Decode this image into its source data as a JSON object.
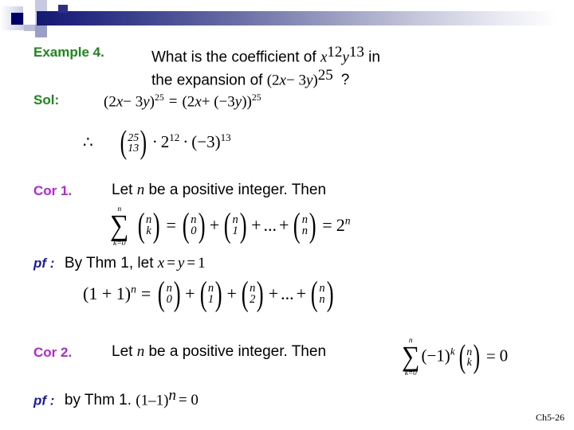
{
  "slide": {
    "footer": "Ch5-26",
    "colors": {
      "example_label": "#1a8a1a",
      "cor_label": "#bb22dd",
      "pf_label": "#1a1aaa",
      "banner_dark": "#141a6e",
      "banner_accent": "#000066"
    }
  },
  "example": {
    "label": "Example 4.",
    "question_line1_pre": "What is the coefficient of ",
    "question_x": "x",
    "question_x_exp": "12",
    "question_y": "y",
    "question_y_exp": "13",
    "question_line1_post": " in",
    "question_line2_pre": "the expansion of ",
    "expr_open": "(2",
    "expr_x": "x",
    "expr_minus": "− 3",
    "expr_y": "y",
    "expr_close": ")",
    "expr_exp": "25",
    "question_mark": "?"
  },
  "sol": {
    "label": "Sol:",
    "equation": {
      "lhs_open": "(2",
      "lhs_x": "x",
      "lhs_minus": "− 3",
      "lhs_y": "y",
      "lhs_close": ")",
      "lhs_exp": "25",
      "equals": "=",
      "rhs_open": "(2",
      "rhs_x": "x",
      "rhs_plus": "+ (−3",
      "rhs_y": "y",
      "rhs_close": "))",
      "rhs_exp": "25"
    },
    "therefore_symbol": "∴",
    "result": {
      "binom_top": "25",
      "binom_bottom": "13",
      "dot1": "·",
      "term2_base": "2",
      "term2_exp": "12",
      "dot2": "·",
      "term3_base": "(−3)",
      "term3_exp": "13"
    }
  },
  "cor1": {
    "label": "Cor 1.",
    "statement_pre": "Let ",
    "statement_var": "n",
    "statement_post": " be a positive integer. Then",
    "formula": {
      "sum_upper": "n",
      "sum_sigma": "∑",
      "sum_lower": "k=0",
      "binom_top": "n",
      "binom_bottom": "k",
      "eq1": "=",
      "b0_top": "n",
      "b0_bottom": "0",
      "plus1": "+",
      "b1_top": "n",
      "b1_bottom": "1",
      "plus2": "+",
      "ellipsis": "...",
      "plus3": "+",
      "bn_top": "n",
      "bn_bottom": "n",
      "eq2": "=",
      "result_base": "2",
      "result_exp": "n"
    }
  },
  "pf1": {
    "label": "pf :",
    "text_pre": "By Thm 1,  let ",
    "var_x": "x",
    "eq1": "=",
    "var_y": "y",
    "eq2": "=",
    "value": "1",
    "formula": {
      "lhs": "(1 + 1)",
      "lhs_exp": "n",
      "equals": "=",
      "b0_top": "n",
      "b0_bottom": "0",
      "plus1": "+",
      "b1_top": "n",
      "b1_bottom": "1",
      "plus2": "+",
      "b2_top": "n",
      "b2_bottom": "2",
      "plus3": "+",
      "ellipsis": "...",
      "plus4": "+",
      "bn_top": "n",
      "bn_bottom": "n"
    }
  },
  "cor2": {
    "label": "Cor 2.",
    "statement_pre": "Let ",
    "statement_var": "n",
    "statement_post": " be a positive integer.  Then",
    "formula": {
      "sum_upper": "n",
      "sum_sigma": "∑",
      "sum_lower": "k=0",
      "factor": "(−1)",
      "factor_exp": "k",
      "binom_top": "n",
      "binom_bottom": "k",
      "equals": "=",
      "result": "0"
    }
  },
  "pf2": {
    "label": "pf :",
    "text": "by Thm 1. ",
    "formula_base": "(1–1)",
    "formula_exp": "n",
    "formula_eq": "= 0"
  }
}
